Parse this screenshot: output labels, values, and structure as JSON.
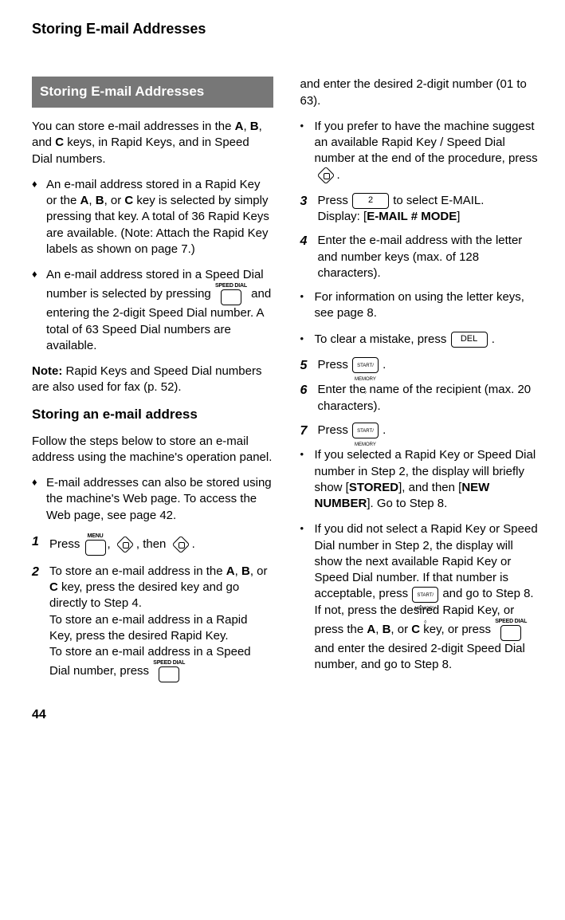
{
  "pageTitle": "Storing E-mail Addresses",
  "banner": "Storing E-mail Addresses",
  "intro": "You can store e-mail addresses in the A, B, and C keys, in Rapid Keys, and in Speed Dial numbers.",
  "bulletA": "An e-mail address stored in a Rapid Key or the A, B, or C key is selected by simply pressing that key. A total of 36 Rapid Keys are available. (Note: Attach the Rapid Key labels as shown on page 7.)",
  "bulletB_pre": "An e-mail address stored in a Speed Dial number is selected by pressing",
  "bulletB_post": "and entering the 2-digit Speed Dial number. A total of 63 Speed Dial numbers are available.",
  "note": "Note: Rapid Keys and Speed Dial numbers are also used for fax (p. 52).",
  "subheading": "Storing an e-mail address",
  "follow": "Follow the steps below to store an e-mail address using the machine's operation panel.",
  "bulletC": "E-mail addresses can also be stored using the machine's Web page. To access the Web page, see page 42.",
  "step1_a": "Press ",
  "step1_b": ", ",
  "step1_c": ", then ",
  "step1_d": ".",
  "step2": "To store an e-mail address in the A, B, or C key, press the desired key and go directly to Step 4.",
  "step2a": "To store an e-mail address in a Rapid Key, press the desired Rapid Key.",
  "step2b_pre": "To store an e-mail address in a Speed Dial number, press ",
  "col2_top": "and enter the desired 2-digit number (01 to 63).",
  "col2_bullet1_pre": "If you prefer to have the machine suggest an available Rapid Key / Speed Dial number at the end of the procedure, press ",
  "step3_a": "Press ",
  "step3_b": " to select E-MAIL.",
  "step3_c": "Display: [E-MAIL # MODE]",
  "step4": "Enter the e-mail address with the letter and number keys (max. of 128 characters).",
  "col2_bullet2": "For information on using the letter keys, see page 8.",
  "col2_bullet3_pre": "To clear a mistake, press ",
  "step5_a": "Press ",
  "step6": "Enter the name of the recipient (max. 20 characters).",
  "step7_a": "Press ",
  "col2_bullet4": "If you  selected a Rapid Key or Speed Dial number in Step 2, the display will briefly show [STORED], and then [NEW NUMBER]. Go to Step 8.",
  "col2_bullet5_a": "If you did not select a Rapid Key or Speed Dial number in Step 2, the display will show the next available Rapid Key or Speed Dial number. If that number is acceptable, press",
  "col2_bullet5_b": " and go to Step 8. If not, press the desired Rapid Key, or press the A, B, or C key,  or press ",
  "col2_bullet5_c": " and enter the desired 2-digit Speed Dial number, and go to Step 8.",
  "pageNumber": "44",
  "labels": {
    "menu": "MENU",
    "speedDial": "SPEED DIAL",
    "startMemory": "START/\nMEMORY",
    "del": "DEL",
    "two": "2"
  }
}
